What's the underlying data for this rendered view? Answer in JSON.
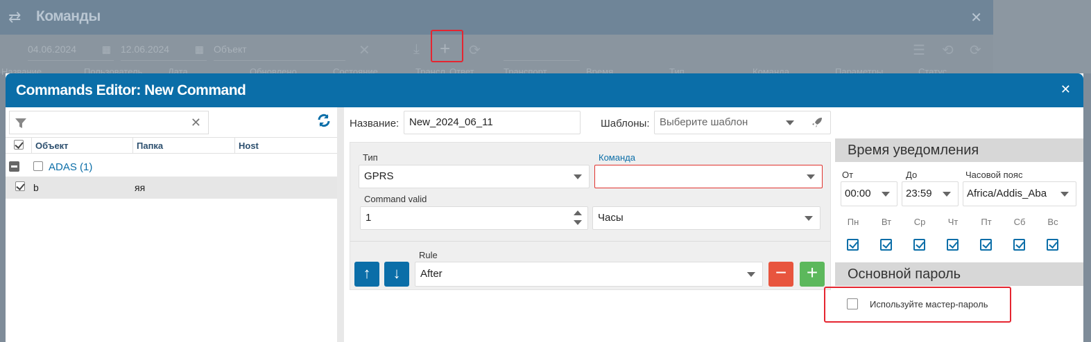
{
  "background": {
    "title": "Команды",
    "date_from": "04.06.2024",
    "date_to": "12.06.2024",
    "object_placeholder": "Объект",
    "columns_left": [
      "Название",
      "Пользователь",
      "Дата",
      "Обновлено",
      "Состояние",
      "Трансл.",
      "Ответ"
    ],
    "columns_right": [
      "Транспорт",
      "Время",
      "Тип",
      "Команда",
      "Параметры",
      "Статус"
    ]
  },
  "modal": {
    "title": "Commands Editor: New Command",
    "left": {
      "columns": [
        "Объект",
        "Папка",
        "Host"
      ],
      "group": {
        "name": "ADAS (1)"
      },
      "rows": [
        {
          "object": "b",
          "folder": "яя",
          "host": ""
        }
      ]
    },
    "form": {
      "name_label": "Название:",
      "name_value": "New_2024_06_11",
      "templates_label": "Шаблоны:",
      "templates_placeholder": "Выберите шаблон",
      "type_label": "Тип",
      "type_value": "GPRS",
      "command_label": "Команда",
      "command_value": "",
      "valid_label": "Command valid",
      "valid_value": "1",
      "unit_value": "Часы",
      "rule_label": "Rule",
      "rule_value": "After"
    },
    "notify": {
      "title": "Время уведомления",
      "from_label": "От",
      "from_value": "00:00",
      "to_label": "До",
      "to_value": "23:59",
      "tz_label": "Часовой пояс",
      "tz_value": "Africa/Addis_Aba",
      "days": [
        "Пн",
        "Вт",
        "Ср",
        "Чт",
        "Пт",
        "Сб",
        "Вс"
      ]
    },
    "password": {
      "title": "Основной пароль",
      "master_label": "Используйте мастер-пароль",
      "checked": false
    }
  },
  "colors": {
    "header": "#0b6ea8",
    "accent_red": "#e52530",
    "remove": "#e8553e",
    "add": "#5cb85c"
  }
}
